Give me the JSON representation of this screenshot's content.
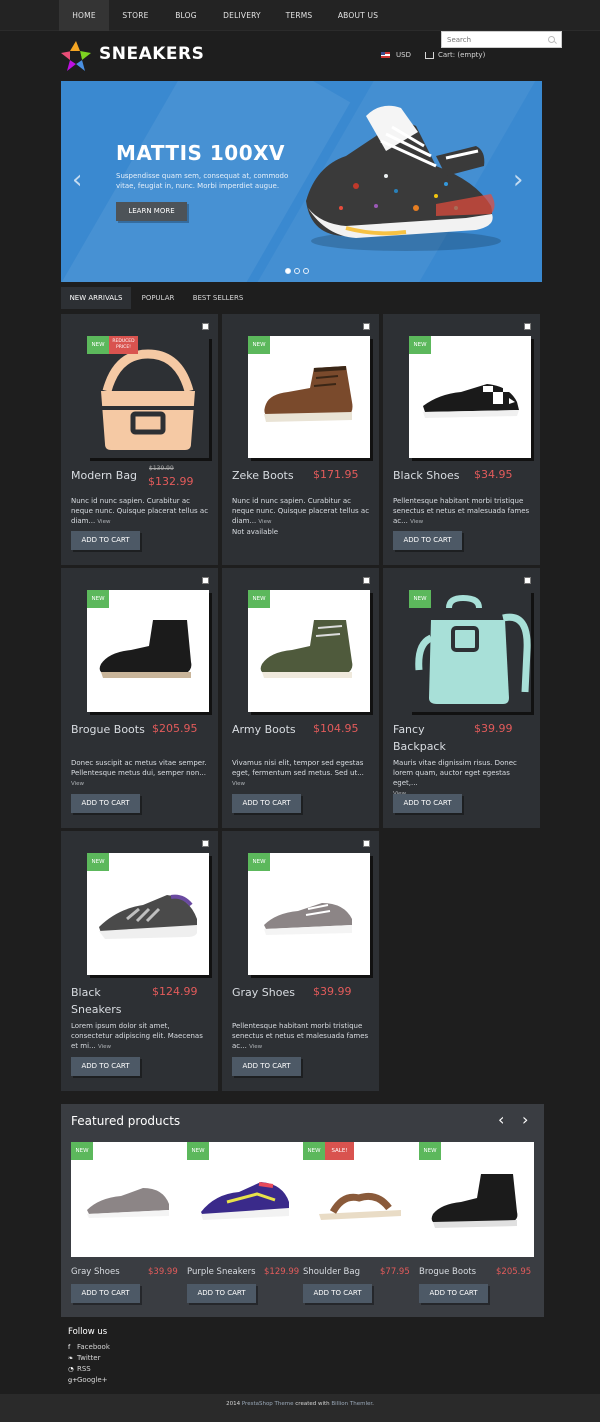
{
  "nav": {
    "items": [
      {
        "label": "HOME",
        "active": true
      },
      {
        "label": "STORE"
      },
      {
        "label": "BLOG"
      },
      {
        "label": "DELIVERY"
      },
      {
        "label": "TERMS"
      },
      {
        "label": "ABOUT US"
      }
    ]
  },
  "header": {
    "logo_text": "SNEAKERS",
    "search_placeholder": "Search",
    "currency": "USD",
    "cart_label": "Cart: (empty)"
  },
  "hero": {
    "title": "MATTIS 100XV",
    "description": "Suspendisse quam sem, consequat at, commodo vitae, feugiat in, nunc. Morbi imperdiet augue.",
    "button": "LEARN MORE",
    "prev_icon": "‹",
    "next_icon": "›",
    "slide_count": 3,
    "active_slide": 1
  },
  "tabs": [
    "NEW ARRIVALS",
    "POPULAR",
    "BEST SELLERS"
  ],
  "badges": {
    "new": "NEW",
    "reduced": "REDUCED PRICE!",
    "sale": "SALE!"
  },
  "products": [
    {
      "name": "Modern Bag",
      "old_price": "$139.99",
      "price": "$132.99",
      "desc": "Nunc id nunc sapien. Curabitur ac neque nunc. Quisque placerat tellus ac diam...",
      "view": "View",
      "button": "ADD TO CART"
    },
    {
      "name": "Zeke Boots",
      "price": "$171.95",
      "desc": "Nunc id nunc sapien. Curabitur ac neque nunc. Quisque placerat tellus ac diam...",
      "view": "View",
      "availability": "Not available",
      "button": "ADD TO CART"
    },
    {
      "name": "Black Shoes",
      "price": "$34.95",
      "desc": "Pellentesque habitant morbi tristique senectus et netus et malesuada fames ac...",
      "view": "View",
      "button": "ADD TO CART"
    },
    {
      "name": "Brogue Boots",
      "price": "$205.95",
      "desc": "Donec suscipit ac metus vitae semper. Pellentesque metus dui, semper non...",
      "view": "View",
      "button": "ADD TO CART"
    },
    {
      "name": "Army Boots",
      "price": "$104.95",
      "desc": "Vivamus nisi elit, tempor sed egestas eget, fermentum sed metus. Sed ut...",
      "view": "View",
      "button": "ADD TO CART"
    },
    {
      "name": "Fancy Backpack",
      "price": "$39.99",
      "desc": "Mauris vitae dignissim risus. Donec lorem quam, auctor eget egestas eget,...",
      "view": "View",
      "button": "ADD TO CART"
    },
    {
      "name": "Black Sneakers",
      "price": "$124.99",
      "desc": "Lorem ipsum dolor sit amet, consectetur adipiscing elit. Maecenas et mi...",
      "view": "View",
      "button": "ADD TO CART"
    },
    {
      "name": "Gray Shoes",
      "price": "$39.99",
      "desc": "Pellentesque habitant morbi tristique senectus et netus et malesuada fames ac...",
      "view": "View",
      "button": "ADD TO CART"
    }
  ],
  "featured": {
    "title": "Featured products",
    "prev_icon": "‹",
    "next_icon": "›",
    "items": [
      {
        "name": "Gray Shoes",
        "price": "$39.99",
        "button": "ADD TO CART"
      },
      {
        "name": "Purple Sneakers",
        "price": "$129.99",
        "button": "ADD TO CART"
      },
      {
        "name": "Shoulder Bag",
        "price": "$77.95",
        "button": "ADD TO CART"
      },
      {
        "name": "Brogue Boots",
        "price": "$205.95",
        "button": "ADD TO CART"
      }
    ]
  },
  "follow": {
    "title": "Follow us",
    "links": [
      {
        "label": "Facebook",
        "icon": "f"
      },
      {
        "label": "Twitter",
        "icon": "❧"
      },
      {
        "label": "RSS",
        "icon": "◔"
      },
      {
        "label": "Google+",
        "icon": "g+"
      }
    ]
  },
  "footer": {
    "year": "2014",
    "theme_link": "PrestaShop Theme",
    "created_with": "created with",
    "author_link": "Billion Themler",
    "period": "."
  }
}
